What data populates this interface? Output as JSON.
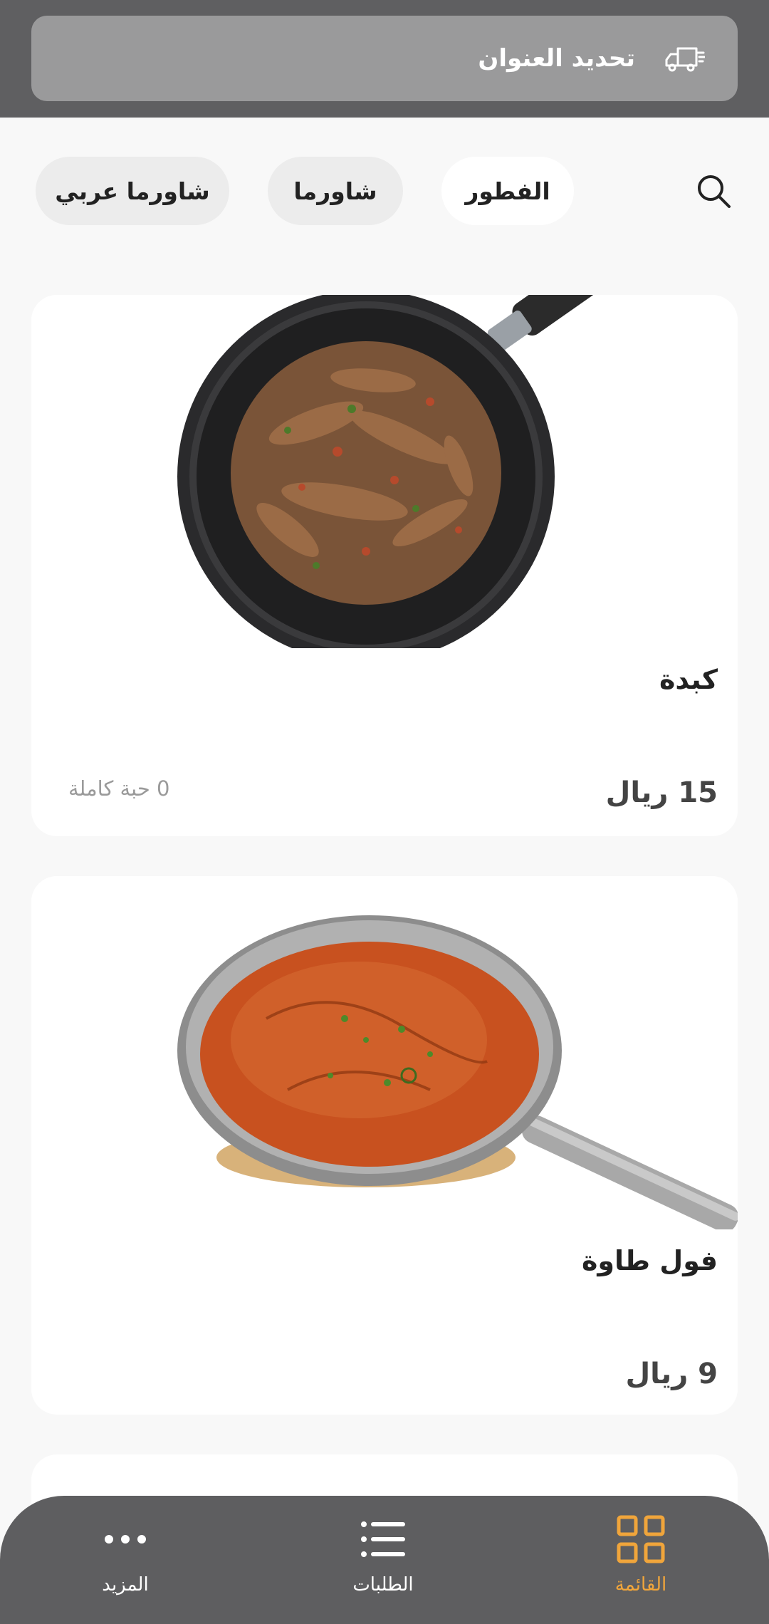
{
  "header": {
    "address_label": "تحديد العنوان",
    "icon": "delivery-truck-icon"
  },
  "filters": {
    "search_icon": "search-icon",
    "chips": [
      {
        "label": "الفطور",
        "active": true
      },
      {
        "label": "شاورما",
        "active": false
      },
      {
        "label": "شاورما عربي",
        "active": false
      }
    ]
  },
  "items": [
    {
      "name": "كبدة",
      "price": "15 ريال",
      "note": "0 حبة كاملة"
    },
    {
      "name": "فول طاوة",
      "price": "9 ريال"
    }
  ],
  "nav": {
    "menu": "القائمة",
    "orders": "الطلبات",
    "more": "المزيد",
    "active_color": "#f0a53b"
  },
  "colors": {
    "top_bar": "#5f5f61",
    "address_pill": "#9a9a9b",
    "bottom_nav": "#5e5e60",
    "accent": "#f0a53b"
  }
}
